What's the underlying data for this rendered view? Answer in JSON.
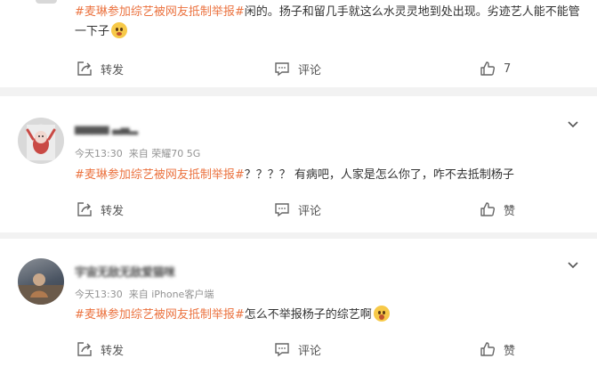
{
  "comments": [
    {
      "hashtag": "#麦琳参加综艺被网友抵制举报#",
      "text": "闲的。扬子和留几手就这么水灵灵地到处出现。劣迹艺人能不能管一下子",
      "emoji": "smile-wink-emoji",
      "actions": {
        "repost": "转发",
        "comment": "评论",
        "like": "7"
      }
    },
    {
      "username": "▅▅▅▅ ▃▄▂",
      "time": "今天13:30",
      "source": "来自 荣耀70 5G",
      "hashtag": "#麦琳参加综艺被网友抵制举报#",
      "text": "？？？？ 有病吧，人家是怎么你了，咋不去抵制杨子",
      "actions": {
        "repost": "转发",
        "comment": "评论",
        "like": "赞"
      }
    },
    {
      "username": "宇宙无敌无敌爱猫咪",
      "time": "今天13:30",
      "source": "来自 iPhone客户端",
      "hashtag": "#麦琳参加综艺被网友抵制举报#",
      "text": "怎么不举报杨子的综艺啊",
      "emoji": "surprised-emoji",
      "actions": {
        "repost": "转发",
        "comment": "评论",
        "like": "赞"
      }
    }
  ],
  "colors": {
    "hashtag": "#eb7340",
    "meta": "#939393",
    "background": "#f2f2f2"
  }
}
